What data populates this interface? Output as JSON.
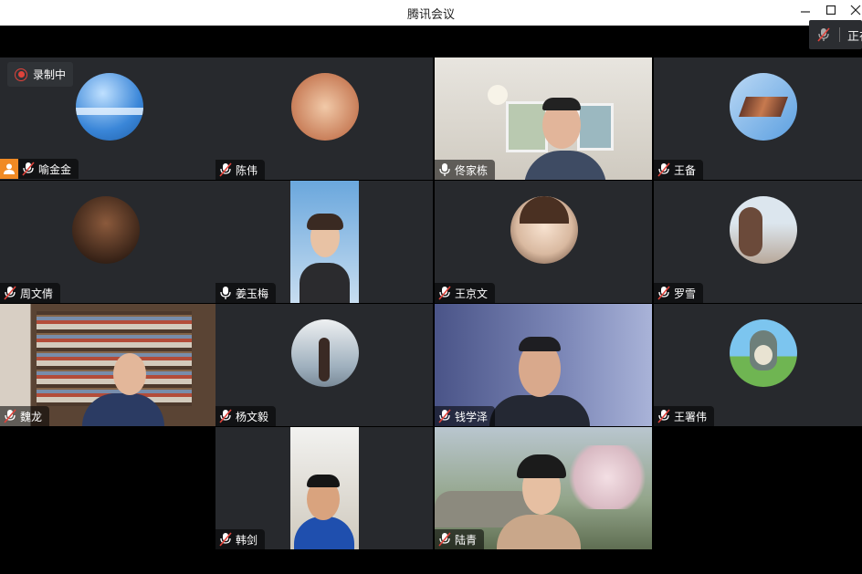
{
  "window": {
    "title": "腾讯会议",
    "status_text": "正在"
  },
  "recording": {
    "label": "录制中"
  },
  "participants": [
    {
      "name": "喻金金",
      "muted": true,
      "host": true
    },
    {
      "name": "陈伟",
      "muted": true
    },
    {
      "name": "佟家栋",
      "muted": false
    },
    {
      "name": "王备",
      "muted": true
    },
    {
      "name": "周文倩",
      "muted": true
    },
    {
      "name": "姜玉梅",
      "muted": false
    },
    {
      "name": "王京文",
      "muted": true
    },
    {
      "name": "罗雪",
      "muted": true
    },
    {
      "name": "魏龙",
      "muted": true
    },
    {
      "name": "杨文毅",
      "muted": true
    },
    {
      "name": "钱学泽",
      "muted": true
    },
    {
      "name": "王署伟",
      "muted": true
    },
    {
      "name": "韩剑",
      "muted": true
    },
    {
      "name": "陆青",
      "muted": true
    }
  ],
  "colors": {
    "tile_bg": "#27292d",
    "record_red": "#e0433b",
    "host_orange": "#f08a24"
  }
}
